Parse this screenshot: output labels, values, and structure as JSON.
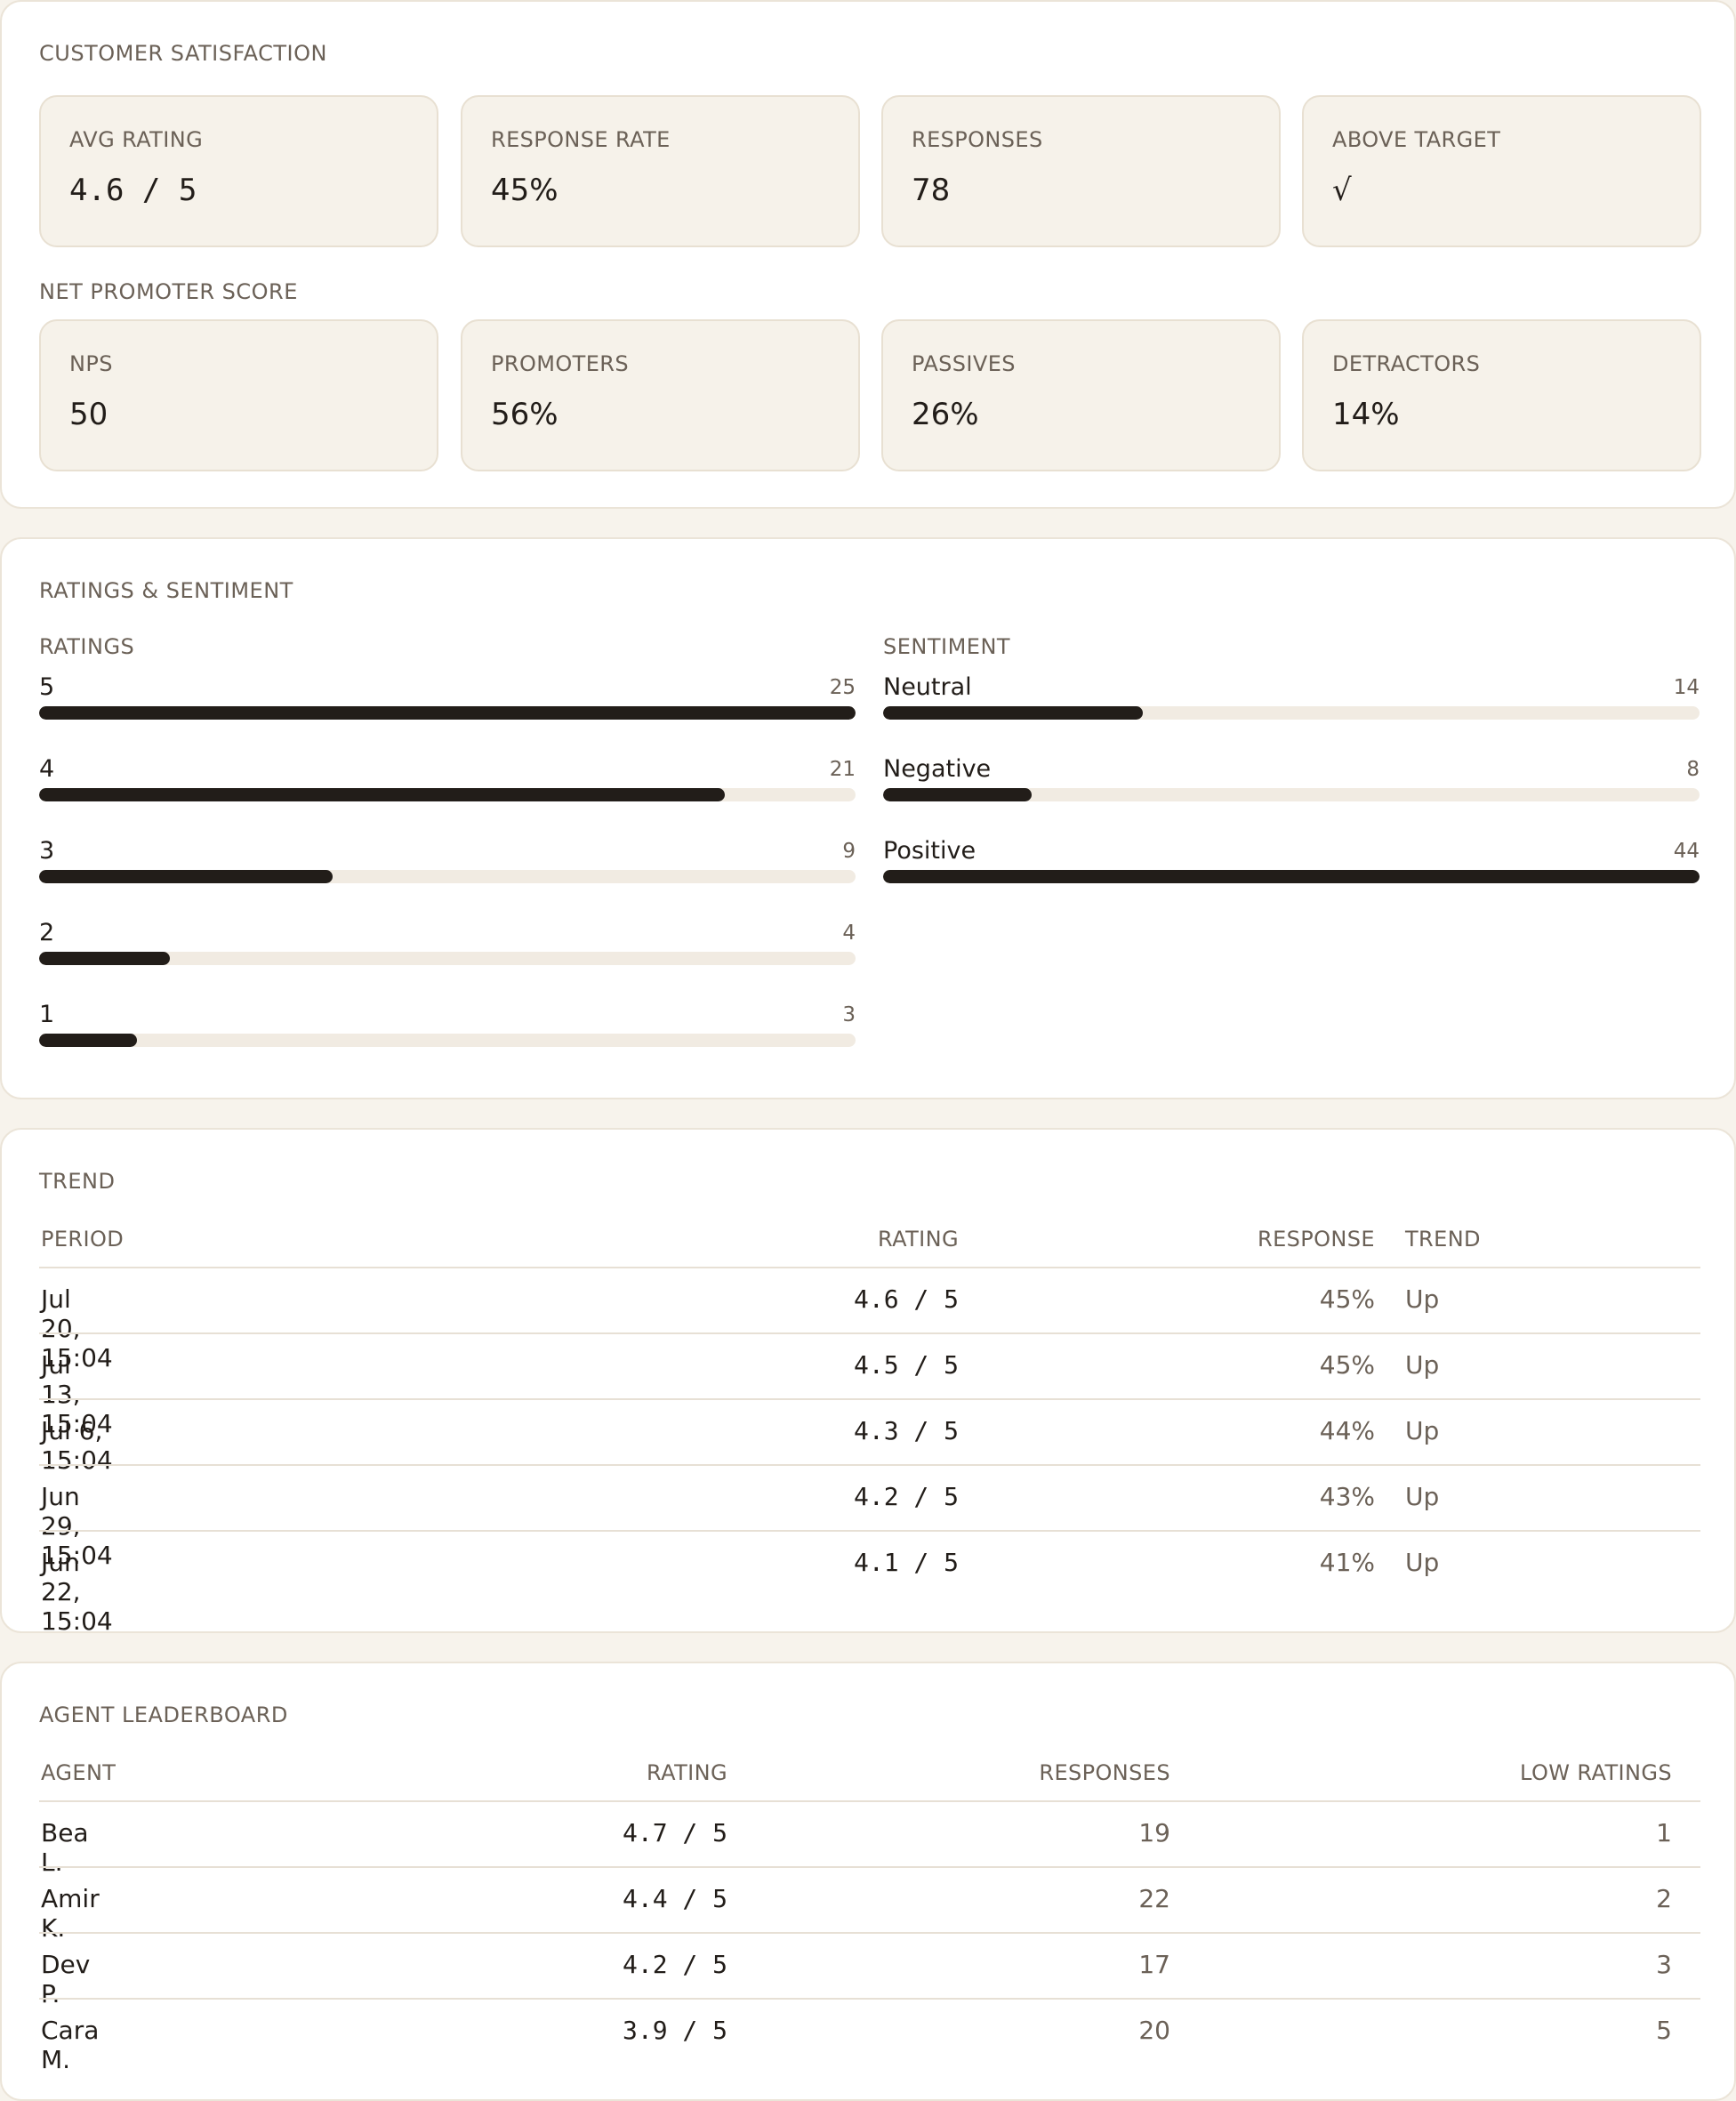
{
  "satisfaction": {
    "title": "CUSTOMER SATISFACTION",
    "kpis": [
      {
        "label": "AVG RATING",
        "value": "4.6 / 5"
      },
      {
        "label": "RESPONSE RATE",
        "value": "45%"
      },
      {
        "label": "RESPONSES",
        "value": "78"
      },
      {
        "label": "ABOVE TARGET",
        "value": "√"
      }
    ],
    "nps_title": "NET PROMOTER SCORE",
    "nps": [
      {
        "label": "NPS",
        "value": "50"
      },
      {
        "label": "PROMOTERS",
        "value": "56%"
      },
      {
        "label": "PASSIVES",
        "value": "26%"
      },
      {
        "label": "DETRACTORS",
        "value": "14%"
      }
    ]
  },
  "ratings_sentiment": {
    "title": "RATINGS & SENTIMENT",
    "ratings_title": "RATINGS",
    "ratings": [
      {
        "label": "5",
        "count": 25
      },
      {
        "label": "4",
        "count": 21
      },
      {
        "label": "3",
        "count": 9
      },
      {
        "label": "2",
        "count": 4
      },
      {
        "label": "1",
        "count": 3
      }
    ],
    "sentiment_title": "SENTIMENT",
    "sentiment": [
      {
        "label": "Neutral",
        "count": 14
      },
      {
        "label": "Negative",
        "count": 8
      },
      {
        "label": "Positive",
        "count": 44
      }
    ]
  },
  "trend": {
    "title": "TREND",
    "headers": {
      "period": "PERIOD",
      "rating": "RATING",
      "response": "RESPONSE",
      "trend": "TREND"
    },
    "rows": [
      {
        "period": "Jul 20, 15:04",
        "rating": "4.6 / 5",
        "response": "45%",
        "trend": "Up"
      },
      {
        "period": "Jul 13, 15:04",
        "rating": "4.5 / 5",
        "response": "45%",
        "trend": "Up"
      },
      {
        "period": "Jul 6, 15:04",
        "rating": "4.3 / 5",
        "response": "44%",
        "trend": "Up"
      },
      {
        "period": "Jun 29, 15:04",
        "rating": "4.2 / 5",
        "response": "43%",
        "trend": "Up"
      },
      {
        "period": "Jun 22, 15:04",
        "rating": "4.1 / 5",
        "response": "41%",
        "trend": "Up"
      }
    ]
  },
  "leaderboard": {
    "title": "AGENT LEADERBOARD",
    "headers": {
      "agent": "AGENT",
      "rating": "RATING",
      "responses": "RESPONSES",
      "low": "LOW RATINGS"
    },
    "rows": [
      {
        "agent": "Bea L.",
        "rating": "4.7 / 5",
        "responses": "19",
        "low": "1"
      },
      {
        "agent": "Amir K.",
        "rating": "4.4 / 5",
        "responses": "22",
        "low": "2"
      },
      {
        "agent": "Dev P.",
        "rating": "4.2 / 5",
        "responses": "17",
        "low": "3"
      },
      {
        "agent": "Cara M.",
        "rating": "3.9 / 5",
        "responses": "20",
        "low": "5"
      }
    ]
  }
}
